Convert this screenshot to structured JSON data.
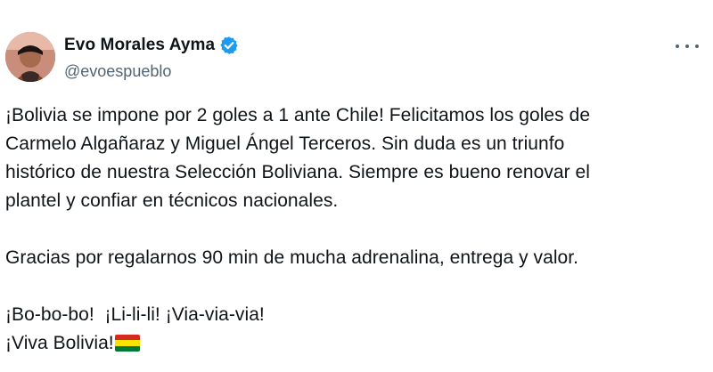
{
  "tweet": {
    "display_name": "Evo Morales Ayma",
    "handle": "@evoespueblo",
    "icons": {
      "verified": "verified-badge-icon",
      "more": "more-options-icon",
      "flag": "bolivia-flag-icon"
    },
    "colors": {
      "verified_blue": "#1d9bf0",
      "text": "#0f1419",
      "secondary": "#536471",
      "flag_red": "#d52b1e",
      "flag_yellow": "#f9e300",
      "flag_green": "#007934"
    },
    "paragraphs": {
      "p1_line1": "¡Bolivia se impone por 2 goles a 1 ante Chile! Felicitamos los goles de",
      "p1_line2": "Carmelo Algañaraz y Miguel Ángel Terceros. Sin duda es un triunfo",
      "p1_line3": "histórico de nuestra Selección Boliviana. Siempre es bueno renovar el",
      "p1_line4": "plantel y confiar en técnicos nacionales.",
      "p2": "Gracias por regalarnos 90 min de mucha adrenalina, entrega y valor.",
      "p3_line1": "¡Bo-bo-bo!  ¡Li-li-li! ¡Via-via-via!",
      "p3_line2": "¡Viva Bolivia!"
    }
  }
}
